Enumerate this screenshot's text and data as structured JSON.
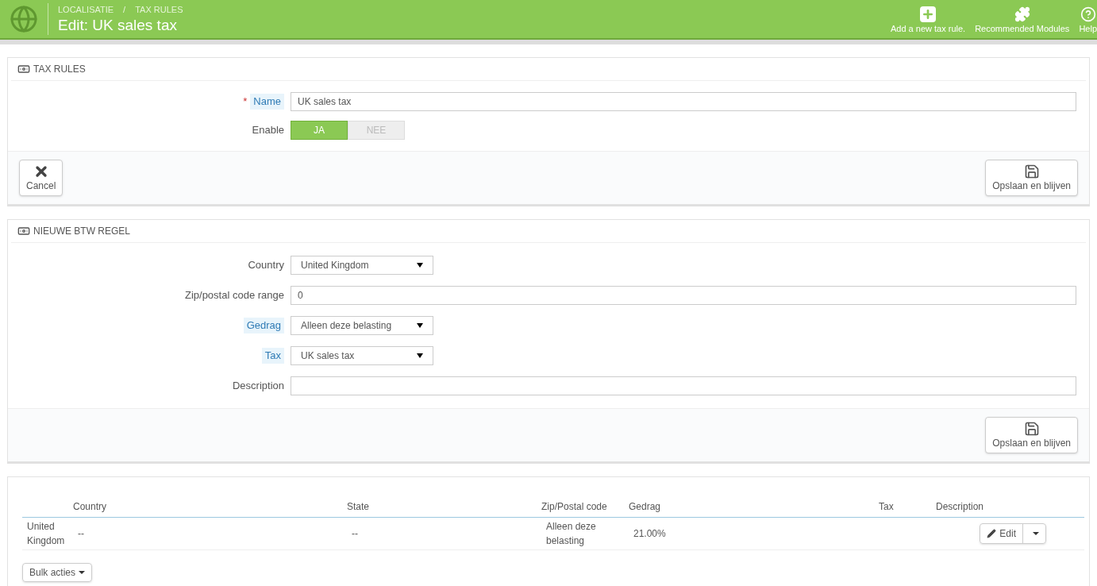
{
  "header": {
    "breadcrumb": [
      "LOCALISATIE",
      "TAX RULES"
    ],
    "separator": "/",
    "title": "Edit: UK sales tax",
    "actions": [
      {
        "kind": "add",
        "label": "Add a new tax rule."
      },
      {
        "kind": "modules",
        "label": "Recommended Modules"
      },
      {
        "kind": "help",
        "label": "Help"
      }
    ]
  },
  "required_sign": "*",
  "panels": [
    {
      "title": "TAX RULES",
      "fields": [
        {
          "kind": "text",
          "label": "Name",
          "required": true,
          "hint": true,
          "value": "UK sales tax"
        },
        {
          "kind": "toggle",
          "label": "Enable",
          "required": false,
          "hint": false,
          "options": [
            {
              "label": "JA",
              "selected": true
            },
            {
              "label": "NEE",
              "selected": false
            }
          ]
        }
      ],
      "footer": {
        "cancel": "Cancel",
        "save": "Opslaan en blijven"
      }
    },
    {
      "title": "NIEUWE BTW REGEL",
      "fields": [
        {
          "kind": "select",
          "label": "Country",
          "required": false,
          "hint": false,
          "value": "United Kingdom"
        },
        {
          "kind": "text",
          "label": "Zip/postal code range",
          "required": false,
          "hint": false,
          "value": "0"
        },
        {
          "kind": "select",
          "label": "Gedrag",
          "required": false,
          "hint": true,
          "value": "Alleen deze belasting"
        },
        {
          "kind": "select",
          "label": "Tax",
          "required": false,
          "hint": true,
          "value": "UK sales tax"
        },
        {
          "kind": "text",
          "label": "Description",
          "required": false,
          "hint": false
        }
      ],
      "footer": {
        "save": "Opslaan en blijven"
      }
    }
  ],
  "table": {
    "columns": [
      {},
      {
        "label": "Country"
      },
      {
        "label": "State"
      },
      {
        "label": "Zip/Postal code"
      },
      {
        "label": "Gedrag"
      },
      {
        "label": "Tax"
      },
      {
        "label": "Description"
      }
    ],
    "rows": [
      {
        "cells": [
          "United Kingdom",
          "--",
          "--",
          "Alleen deze belasting",
          "21.00%"
        ],
        "edit": "Edit"
      }
    ],
    "bulk": "Bulk acties"
  }
}
